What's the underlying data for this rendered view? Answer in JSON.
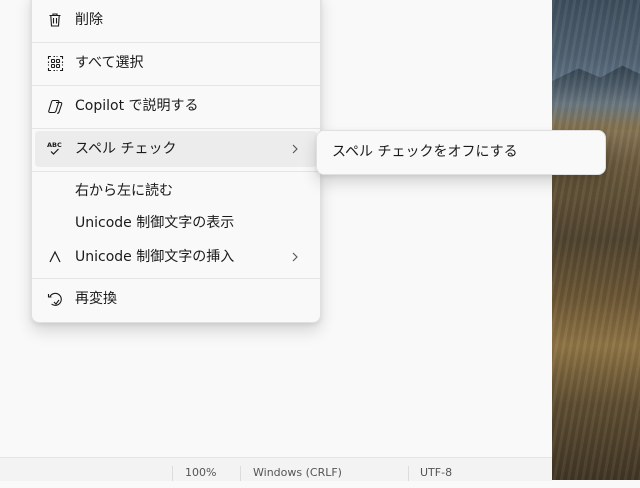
{
  "menu": {
    "items": [
      {
        "label": "削除",
        "icon": "trash-icon"
      },
      {
        "label": "すべて選択",
        "icon": "select-all-icon"
      },
      {
        "label": "Copilot で説明する",
        "icon": "copilot-icon"
      },
      {
        "label": "スペル チェック",
        "icon": "spellcheck-icon",
        "has_submenu": true
      },
      {
        "label": "右から左に読む"
      },
      {
        "label": "Unicode 制御文字の表示"
      },
      {
        "label": "Unicode 制御文字の挿入",
        "icon": "caret-icon",
        "has_submenu": true
      },
      {
        "label": "再変換",
        "icon": "reconvert-icon"
      }
    ]
  },
  "submenu": {
    "items": [
      {
        "label": "スペル チェックをオフにする"
      }
    ]
  },
  "statusbar": {
    "zoom": "100%",
    "line_ending": "Windows (CRLF)",
    "encoding": "UTF-8"
  }
}
